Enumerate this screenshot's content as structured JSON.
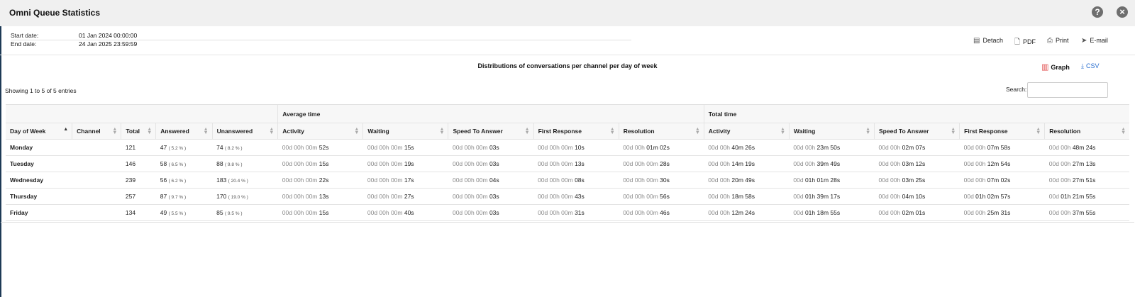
{
  "window": {
    "title": "Omni Queue Statistics"
  },
  "dates": {
    "start_label": "Start date:",
    "start_value": "01 Jan 2024 00:00:00",
    "end_label": "End date:",
    "end_value": "24 Jan 2025 23:59:59"
  },
  "actions": {
    "detach": "Detach",
    "pdf": "PDF",
    "print": "Print",
    "email": "E-mail"
  },
  "report": {
    "title": "Distributions of conversations per channel per day of week",
    "graph": "Graph",
    "csv": "CSV"
  },
  "table_info": {
    "showing": "Showing 1 to 5 of 5 entries",
    "search_label": "Search:",
    "search_value": ""
  },
  "table": {
    "groups": {
      "average": "Average time",
      "total": "Total time"
    },
    "columns": [
      "Day of Week",
      "Channel",
      "Total",
      "Answered",
      "Unanswered",
      "Activity",
      "Waiting",
      "Speed To Answer",
      "First Response",
      "Resolution",
      "Activity",
      "Waiting",
      "Speed To Answer",
      "First Response",
      "Resolution"
    ],
    "rows": [
      {
        "day": "Monday",
        "channel": "",
        "total": "121",
        "answered": "47",
        "answered_pct": "( 5.2 % )",
        "unanswered": "74",
        "unanswered_pct": "( 8.2 % )",
        "avg_activity": [
          "00d 00h 00m ",
          "52s"
        ],
        "avg_waiting": [
          "00d 00h 00m ",
          "15s"
        ],
        "avg_speed": [
          "00d 00h 00m ",
          "03s"
        ],
        "avg_first": [
          "00d 00h 00m ",
          "10s"
        ],
        "avg_resolution": [
          "00d 00h ",
          "01m 02s"
        ],
        "tot_activity": [
          "00d 00h ",
          "40m 26s"
        ],
        "tot_waiting": [
          "00d 00h ",
          "23m 50s"
        ],
        "tot_speed": [
          "00d 00h ",
          "02m 07s"
        ],
        "tot_first": [
          "00d 00h ",
          "07m 58s"
        ],
        "tot_resolution": [
          "00d 00h ",
          "48m 24s"
        ]
      },
      {
        "day": "Tuesday",
        "channel": "",
        "total": "146",
        "answered": "58",
        "answered_pct": "( 6.5 % )",
        "unanswered": "88",
        "unanswered_pct": "( 9.8 % )",
        "avg_activity": [
          "00d 00h 00m ",
          "15s"
        ],
        "avg_waiting": [
          "00d 00h 00m ",
          "19s"
        ],
        "avg_speed": [
          "00d 00h 00m ",
          "03s"
        ],
        "avg_first": [
          "00d 00h 00m ",
          "13s"
        ],
        "avg_resolution": [
          "00d 00h 00m ",
          "28s"
        ],
        "tot_activity": [
          "00d 00h ",
          "14m 19s"
        ],
        "tot_waiting": [
          "00d 00h ",
          "39m 49s"
        ],
        "tot_speed": [
          "00d 00h ",
          "03m 12s"
        ],
        "tot_first": [
          "00d 00h ",
          "12m 54s"
        ],
        "tot_resolution": [
          "00d 00h ",
          "27m 13s"
        ]
      },
      {
        "day": "Wednesday",
        "channel": "",
        "total": "239",
        "answered": "56",
        "answered_pct": "( 6.2 % )",
        "unanswered": "183",
        "unanswered_pct": "( 20.4 % )",
        "avg_activity": [
          "00d 00h 00m ",
          "22s"
        ],
        "avg_waiting": [
          "00d 00h 00m ",
          "17s"
        ],
        "avg_speed": [
          "00d 00h 00m ",
          "04s"
        ],
        "avg_first": [
          "00d 00h 00m ",
          "08s"
        ],
        "avg_resolution": [
          "00d 00h 00m ",
          "30s"
        ],
        "tot_activity": [
          "00d 00h ",
          "20m 49s"
        ],
        "tot_waiting": [
          "00d ",
          "01h 01m 28s"
        ],
        "tot_speed": [
          "00d 00h ",
          "03m 25s"
        ],
        "tot_first": [
          "00d 00h ",
          "07m 02s"
        ],
        "tot_resolution": [
          "00d 00h ",
          "27m 51s"
        ]
      },
      {
        "day": "Thursday",
        "channel": "",
        "total": "257",
        "answered": "87",
        "answered_pct": "( 9.7 % )",
        "unanswered": "170",
        "unanswered_pct": "( 19.0 % )",
        "avg_activity": [
          "00d 00h 00m ",
          "13s"
        ],
        "avg_waiting": [
          "00d 00h 00m ",
          "27s"
        ],
        "avg_speed": [
          "00d 00h 00m ",
          "03s"
        ],
        "avg_first": [
          "00d 00h 00m ",
          "43s"
        ],
        "avg_resolution": [
          "00d 00h 00m ",
          "56s"
        ],
        "tot_activity": [
          "00d 00h ",
          "18m 58s"
        ],
        "tot_waiting": [
          "00d ",
          "01h 39m 17s"
        ],
        "tot_speed": [
          "00d 00h ",
          "04m 10s"
        ],
        "tot_first": [
          "00d ",
          "01h 02m 57s"
        ],
        "tot_resolution": [
          "00d ",
          "01h 21m 55s"
        ]
      },
      {
        "day": "Friday",
        "channel": "",
        "total": "134",
        "answered": "49",
        "answered_pct": "( 5.5 % )",
        "unanswered": "85",
        "unanswered_pct": "( 9.5 % )",
        "avg_activity": [
          "00d 00h 00m ",
          "15s"
        ],
        "avg_waiting": [
          "00d 00h 00m ",
          "40s"
        ],
        "avg_speed": [
          "00d 00h 00m ",
          "03s"
        ],
        "avg_first": [
          "00d 00h 00m ",
          "31s"
        ],
        "avg_resolution": [
          "00d 00h 00m ",
          "46s"
        ],
        "tot_activity": [
          "00d 00h ",
          "12m 24s"
        ],
        "tot_waiting": [
          "00d ",
          "01h 18m 55s"
        ],
        "tot_speed": [
          "00d 00h ",
          "02m 01s"
        ],
        "tot_first": [
          "00d 00h ",
          "25m 31s"
        ],
        "tot_resolution": [
          "00d 00h ",
          "37m 55s"
        ]
      }
    ]
  },
  "icons": {
    "help": "help-icon",
    "close": "close-icon",
    "detach": "detach-icon",
    "pdf": "pdf-icon",
    "print": "print-icon",
    "email": "email-icon",
    "graph": "bar-chart-icon",
    "csv": "download-icon"
  },
  "colors": {
    "title_bar": "#f0f0f0",
    "graph_icon": "#e04848",
    "csv_link": "#2a6fd0",
    "left_bar": "#1e3a56"
  }
}
